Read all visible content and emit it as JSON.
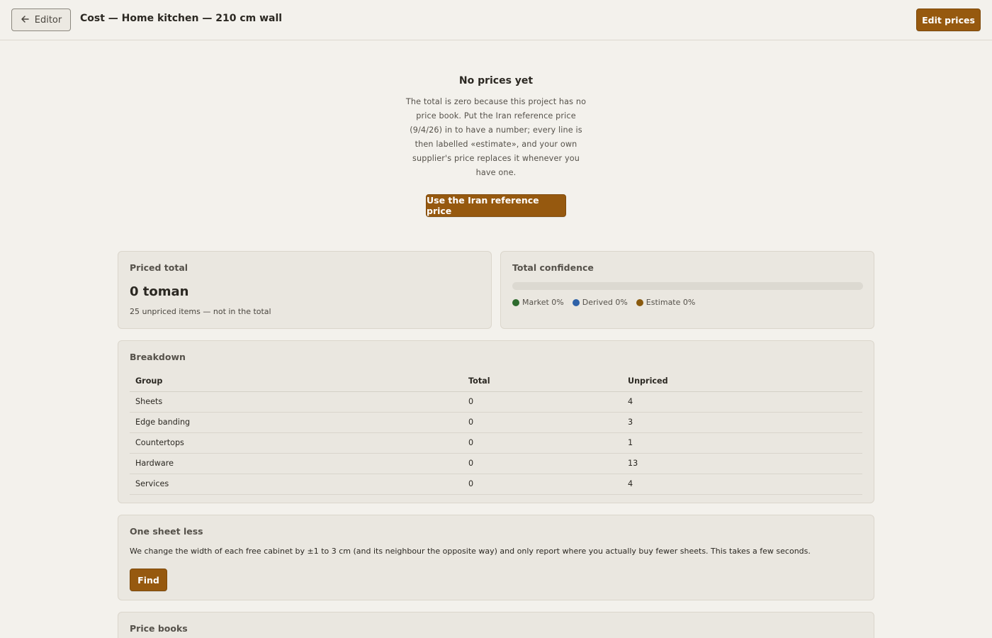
{
  "header": {
    "back_label": "Editor",
    "back_icon": "arrow-left-icon",
    "title": "Cost — Home kitchen — 210 cm wall",
    "edit_prices_label": "Edit prices"
  },
  "empty_state": {
    "title": "No prices yet",
    "description": "The total is zero because this project has no price book. Put the Iran reference price (9/4/26) in to have a number; every line is then labelled «estimate», and your own supplier's price replaces it whenever you have one.",
    "action_label": "Use the Iran reference price"
  },
  "priced_total": {
    "label": "Priced total",
    "value": "0 toman",
    "note": "25 unpriced items — not in the total"
  },
  "confidence": {
    "label": "Total confidence",
    "bar_level": 0,
    "legend": [
      {
        "label": "Market 0%",
        "color": "#2e6b2e"
      },
      {
        "label": "Derived 0%",
        "color": "#2f62a8"
      },
      {
        "label": "Estimate 0%",
        "color": "#8a5a0e"
      }
    ]
  },
  "breakdown": {
    "label": "Breakdown",
    "columns": [
      "Group",
      "Total",
      "Unpriced"
    ],
    "rows": [
      [
        "Sheets",
        "0",
        "4"
      ],
      [
        "Edge banding",
        "0",
        "3"
      ],
      [
        "Countertops",
        "0",
        "1"
      ],
      [
        "Hardware",
        "0",
        "13"
      ],
      [
        "Services",
        "0",
        "4"
      ]
    ]
  },
  "one_sheet_less": {
    "label": "One sheet less",
    "description": "We change the width of each free cabinet by ±1 to 3 cm (and its neighbour the opposite way) and only report where you actually buy fewer sheets. This takes a few seconds.",
    "action_label": "Find"
  },
  "price_books": {
    "label": "Price books"
  },
  "colors": {
    "accent": "#96590f",
    "background": "#f3f1ec",
    "card": "#eae7e0"
  }
}
